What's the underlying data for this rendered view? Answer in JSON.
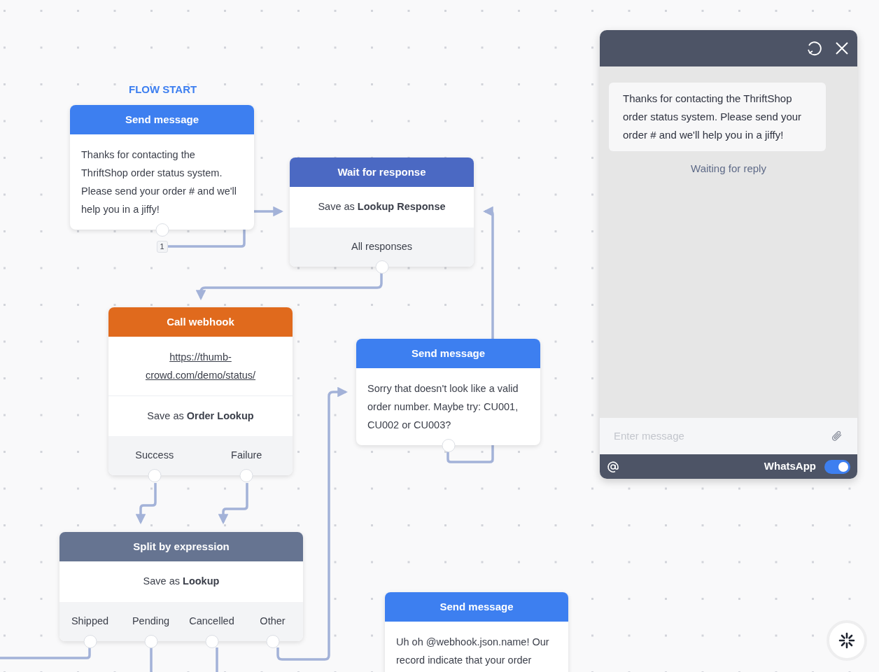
{
  "flow_start": {
    "label": "FLOW START"
  },
  "nodes": [
    {
      "kind": "send_message",
      "title": "Send message",
      "sections": [
        {
          "kind": "text",
          "text": "Thanks for contacting the ThriftShop order status system. Please send your order # and we'll help you in a jiffy!"
        }
      ],
      "exit_count": "1"
    },
    {
      "kind": "wait_for_response",
      "title": "Wait for response",
      "sections": [
        {
          "kind": "save",
          "text": "Save as **Lookup Response**"
        }
      ],
      "exits": [
        {
          "label": "All responses"
        }
      ]
    },
    {
      "kind": "call_webhook",
      "title": "Call webhook",
      "sections": [
        {
          "kind": "link",
          "text": "https://thumb-crowd.com/demo/status/"
        },
        {
          "kind": "save",
          "text": "Save as **Order Lookup**"
        }
      ],
      "exits": [
        {
          "label": "Success"
        },
        {
          "label": "Failure"
        }
      ]
    },
    {
      "kind": "send_message",
      "title": "Send message",
      "sections": [
        {
          "kind": "text",
          "text": "Sorry that doesn't look like a valid order number. Maybe try: CU001, CU002 or CU003?"
        }
      ]
    },
    {
      "kind": "split_by_expression",
      "title": "Split by expression",
      "sections": [
        {
          "kind": "save",
          "text": "Save as **Lookup**"
        }
      ],
      "exits": [
        {
          "label": "Shipped"
        },
        {
          "label": "Pending"
        },
        {
          "label": "Cancelled"
        },
        {
          "label": "Other"
        }
      ]
    },
    {
      "kind": "send_message",
      "title": "Send message",
      "sections": [
        {
          "kind": "text",
          "text": "Uh oh @webhook.json.name! Our record indicate that your order"
        }
      ]
    }
  ],
  "chat": {
    "messages": [
      {
        "text": "Thanks for contacting the ThriftShop order status system. Please send your order # and we'll help you in a jiffy!"
      }
    ],
    "status": "Waiting for reply",
    "input": {
      "placeholder": "Enter message"
    },
    "channel": {
      "label": "WhatsApp",
      "on": true
    }
  }
}
